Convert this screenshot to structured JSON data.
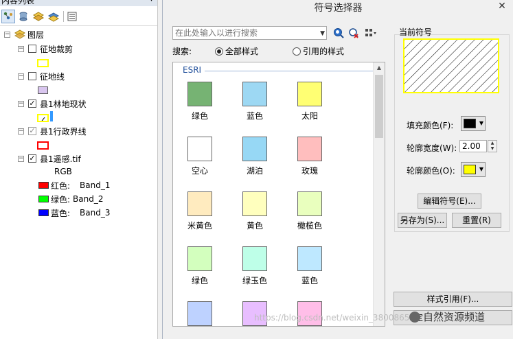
{
  "toc": {
    "title": "内容列表",
    "pin_glyph": "▾",
    "layer_root": "图层",
    "layers": [
      {
        "name": "征地裁剪",
        "checked": false
      },
      {
        "name": "征地线",
        "checked": false
      },
      {
        "name": "县1林地现状",
        "checked": true
      },
      {
        "name": "县1行政界线",
        "checked": true
      },
      {
        "name": "县1遥感.tif",
        "checked": true
      }
    ],
    "raster": {
      "mode": "RGB",
      "bands": [
        {
          "label": "红色:",
          "band": "Band_1",
          "color": "#ff0000"
        },
        {
          "label": "绿色:",
          "band": "Band_2",
          "color": "#00ff00"
        },
        {
          "label": "蓝色:",
          "band": "Band_3",
          "color": "#0000ff"
        }
      ]
    },
    "swatch_colors": {
      "clip": "#ffff00",
      "line": "#d9c6ef",
      "forest": "#ffff00",
      "boundary": "#ff0000"
    }
  },
  "dialog": {
    "title": "符号选择器",
    "close_glyph": "✕",
    "search": {
      "placeholder": "在此处输入以进行搜索",
      "label": "搜索:",
      "opt_all": "全部样式",
      "opt_ref": "引用的样式"
    },
    "gallery": {
      "group": "ESRI",
      "symbols": [
        {
          "name": "绿色",
          "color": "#76b373"
        },
        {
          "name": "蓝色",
          "color": "#9dd8f3"
        },
        {
          "name": "太阳",
          "color": "#ffff73"
        },
        {
          "name": "空心",
          "color": "#ffffff"
        },
        {
          "name": "湖泊",
          "color": "#97d8f5"
        },
        {
          "name": "玫瑰",
          "color": "#ffbebe"
        },
        {
          "name": "米黄色",
          "color": "#ffebbf"
        },
        {
          "name": "黄色",
          "color": "#ffffbe"
        },
        {
          "name": "橄榄色",
          "color": "#e9ffbe"
        },
        {
          "name": "绿色",
          "color": "#d3ffbe"
        },
        {
          "name": "绿玉色",
          "color": "#beffe8"
        },
        {
          "name": "蓝色",
          "color": "#bee8ff"
        },
        {
          "name": "",
          "color": "#bed2ff"
        },
        {
          "name": "",
          "color": "#e8beff"
        },
        {
          "name": "",
          "color": "#ffbee8"
        }
      ]
    },
    "current_symbol": "当前符号",
    "fill_color_label": "填充颜色(F):",
    "fill_color": "#000000",
    "outline_width_label": "轮廓宽度(W):",
    "outline_width": "2.00",
    "outline_color_label": "轮廓颜色(O):",
    "outline_color": "#ffff00",
    "edit_symbol": "编辑符号(E)...",
    "save_as": "另存为(S)...",
    "reset": "重置(R)",
    "style_refs": "样式引用(F)...",
    "ok": "定"
  },
  "watermark": {
    "url": "https://blog.csdn.net/weixin_38008652",
    "brand": "自然资源频道"
  }
}
